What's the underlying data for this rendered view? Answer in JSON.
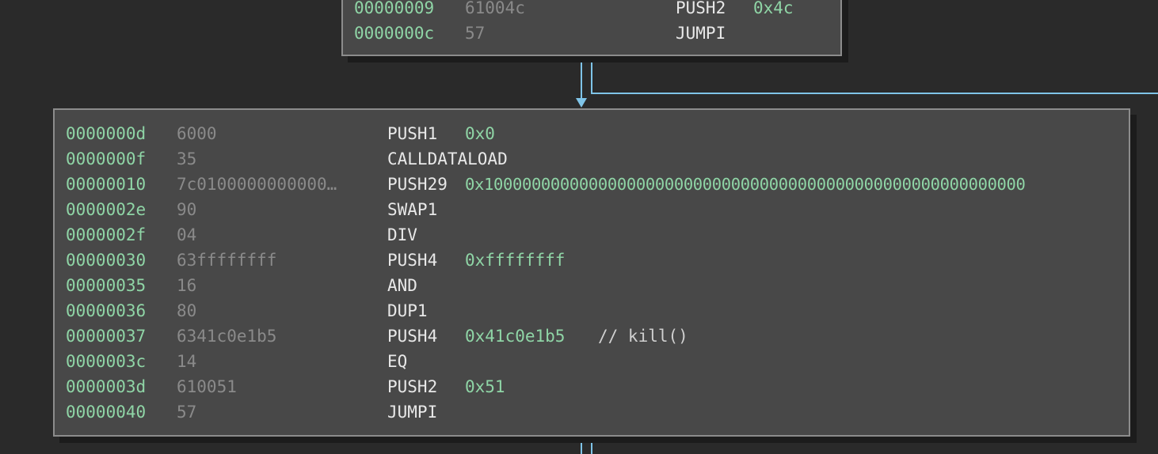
{
  "graph": {
    "top_block": {
      "rows": [
        {
          "addr": "00000009",
          "bytes": "61004c",
          "mnemonic": "PUSH2",
          "operand": "0x4c",
          "comment": ""
        },
        {
          "addr": "0000000c",
          "bytes": "57",
          "mnemonic": "JUMPI",
          "operand": "",
          "comment": ""
        }
      ]
    },
    "main_block": {
      "rows": [
        {
          "addr": "0000000d",
          "bytes": "6000",
          "mnemonic": "PUSH1",
          "operand": "0x0",
          "comment": ""
        },
        {
          "addr": "0000000f",
          "bytes": "35",
          "mnemonic": "CALLDATALOAD",
          "operand": "",
          "comment": ""
        },
        {
          "addr": "00000010",
          "bytes": "7c0100000000000…",
          "mnemonic": "PUSH29",
          "operand": "0x100000000000000000000000000000000000000000000000000000000",
          "comment": ""
        },
        {
          "addr": "0000002e",
          "bytes": "90",
          "mnemonic": "SWAP1",
          "operand": "",
          "comment": ""
        },
        {
          "addr": "0000002f",
          "bytes": "04",
          "mnemonic": "DIV",
          "operand": "",
          "comment": ""
        },
        {
          "addr": "00000030",
          "bytes": "63ffffffff",
          "mnemonic": "PUSH4",
          "operand": "0xffffffff",
          "comment": ""
        },
        {
          "addr": "00000035",
          "bytes": "16",
          "mnemonic": "AND",
          "operand": "",
          "comment": ""
        },
        {
          "addr": "00000036",
          "bytes": "80",
          "mnemonic": "DUP1",
          "operand": "",
          "comment": ""
        },
        {
          "addr": "00000037",
          "bytes": "6341c0e1b5",
          "mnemonic": "PUSH4",
          "operand": "0x41c0e1b5",
          "comment": "// kill()"
        },
        {
          "addr": "0000003c",
          "bytes": "14",
          "mnemonic": "EQ",
          "operand": "",
          "comment": ""
        },
        {
          "addr": "0000003d",
          "bytes": "610051",
          "mnemonic": "PUSH2",
          "operand": "0x51",
          "comment": ""
        },
        {
          "addr": "00000040",
          "bytes": "57",
          "mnemonic": "JUMPI",
          "operand": "",
          "comment": ""
        }
      ]
    }
  },
  "colors": {
    "background": "#2a2a2a",
    "block_fill": "#484848",
    "address": "#8fd5a6",
    "bytes": "#8a8a8a",
    "edge": "#7fc4e8"
  }
}
